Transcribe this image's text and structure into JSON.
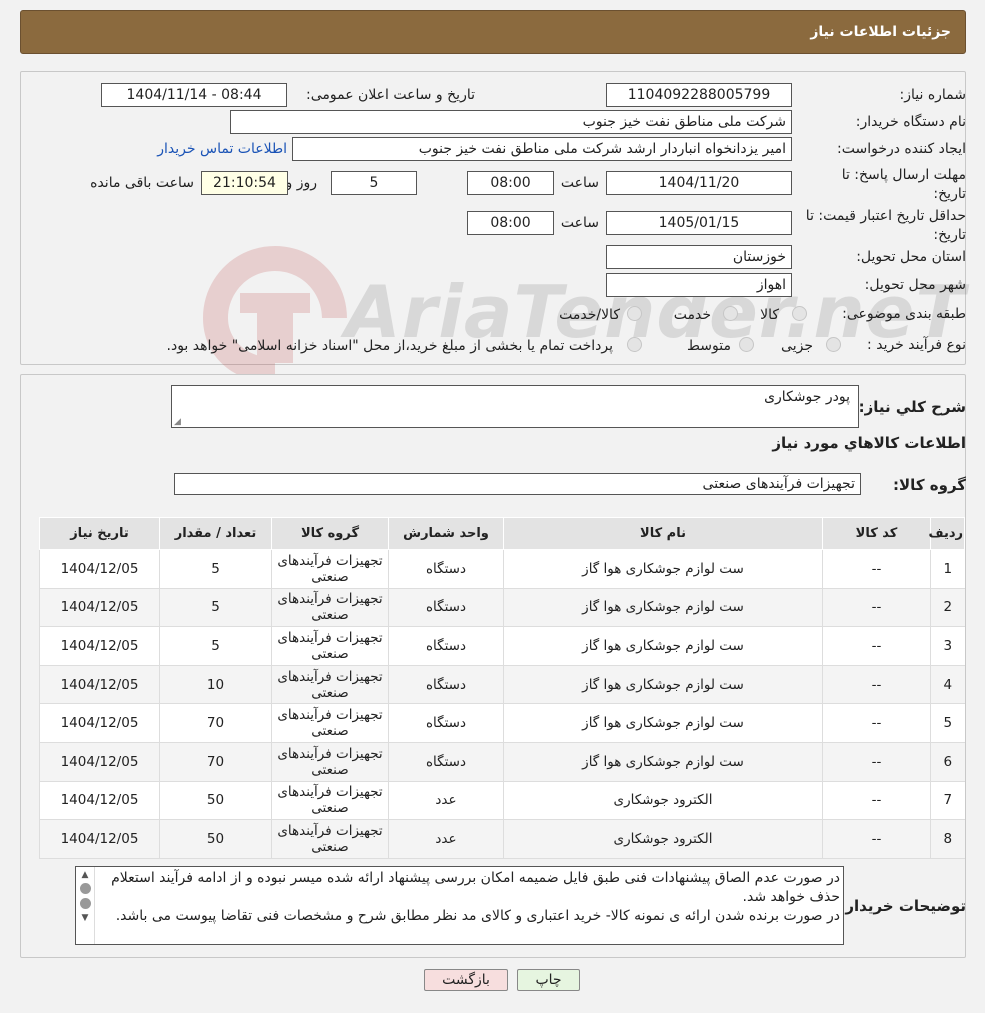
{
  "header": {
    "title": "جزئیات اطلاعات نیاز"
  },
  "form": {
    "need_number_label": "شماره نیاز:",
    "need_number": "1104092288005799",
    "announce_label": "تاریخ و ساعت اعلان عمومی:",
    "announce_value": "1404/11/14 - 08:44",
    "buyer_org_label": "نام دستگاه خریدار:",
    "buyer_org": "شرکت ملی مناطق نفت خیز جنوب",
    "creator_label": "ایجاد کننده درخواست:",
    "creator": "امیر یزدانخواه انباردار ارشد شرکت ملی مناطق نفت خیز جنوب",
    "contact_link": "اطلاعات تماس خریدار",
    "reply_deadline_label": "مهلت ارسال پاسخ: تا تاریخ:",
    "reply_date": "1404/11/20",
    "time_label": "ساعت",
    "reply_time": "08:00",
    "days_value": "5",
    "days_label": "روز و",
    "remaining_time": "21:10:54",
    "remaining_label": "ساعت باقی مانده",
    "validity_label": "حداقل تاریخ اعتبار قیمت: تا تاریخ:",
    "validity_date": "1405/01/15",
    "validity_time": "08:00",
    "province_label": "استان محل تحویل:",
    "province": "خوزستان",
    "city_label": "شهر محل تحویل:",
    "city": "اهواز",
    "category_label": "طبقه بندی موضوعی:",
    "category_options": [
      "کالا",
      "خدمت",
      "کالا/خدمت"
    ],
    "process_label": "نوع فرآیند خرید :",
    "process_options": [
      "جزیی",
      "متوسط"
    ],
    "process_note": "پرداخت تمام یا بخشی از مبلغ خرید،از محل \"اسناد خزانه اسلامی\" خواهد بود."
  },
  "details": {
    "summary_label": "شرح کلي نياز:",
    "summary": "پودر جوشکاری",
    "items_title": "اطلاعات کالاهاي مورد نياز",
    "group_label": "گروه کالا:",
    "group": "تجهیزات فرآیندهای صنعتی"
  },
  "table": {
    "headers": [
      "رديف",
      "کد کالا",
      "نام کالا",
      "واحد شمارش",
      "گروه کالا",
      "تعداد / مقدار",
      "تاریخ نیاز"
    ],
    "rows": [
      [
        "1",
        "--",
        "ست لوازم جوشکاری هوا گاز",
        "دستگاه",
        "تجهیزات فرآیندهای صنعتی",
        "5",
        "1404/12/05"
      ],
      [
        "2",
        "--",
        "ست لوازم جوشکاری هوا گاز",
        "دستگاه",
        "تجهیزات فرآیندهای صنعتی",
        "5",
        "1404/12/05"
      ],
      [
        "3",
        "--",
        "ست لوازم جوشکاری هوا گاز",
        "دستگاه",
        "تجهیزات فرآیندهای صنعتی",
        "5",
        "1404/12/05"
      ],
      [
        "4",
        "--",
        "ست لوازم جوشکاری هوا گاز",
        "دستگاه",
        "تجهیزات فرآیندهای صنعتی",
        "10",
        "1404/12/05"
      ],
      [
        "5",
        "--",
        "ست لوازم جوشکاری هوا گاز",
        "دستگاه",
        "تجهیزات فرآیندهای صنعتی",
        "70",
        "1404/12/05"
      ],
      [
        "6",
        "--",
        "ست لوازم جوشکاری هوا گاز",
        "دستگاه",
        "تجهیزات فرآیندهای صنعتی",
        "70",
        "1404/12/05"
      ],
      [
        "7",
        "--",
        "الکترود جوشکاری",
        "عدد",
        "تجهیزات فرآیندهای صنعتی",
        "50",
        "1404/12/05"
      ],
      [
        "8",
        "--",
        "الکترود جوشکاری",
        "عدد",
        "تجهیزات فرآیندهای صنعتی",
        "50",
        "1404/12/05"
      ]
    ]
  },
  "notes": {
    "label": "توضیحات خریدار:",
    "text": "در صورت عدم الصاق پیشنهادات فنی طبق فایل ضمیمه امکان بررسی پیشنهاد ارائه شده میسر نبوده و از ادامه فرآیند استعلام حذف خواهد شد.\nدر صورت برنده شدن ارائه ی نمونه کالا- خرید اعتباری و کالای مد نظر مطابق شرح و مشخصات فنی تقاضا پیوست می باشد."
  },
  "buttons": {
    "print": "چاپ",
    "back": "بازگشت"
  },
  "watermark": {
    "text": "AriaTender.neT"
  },
  "colors": {
    "header": "#8b6a3e",
    "link": "#1a53b6",
    "back_button": "#f7dede",
    "print_button": "#e6f5e0"
  }
}
